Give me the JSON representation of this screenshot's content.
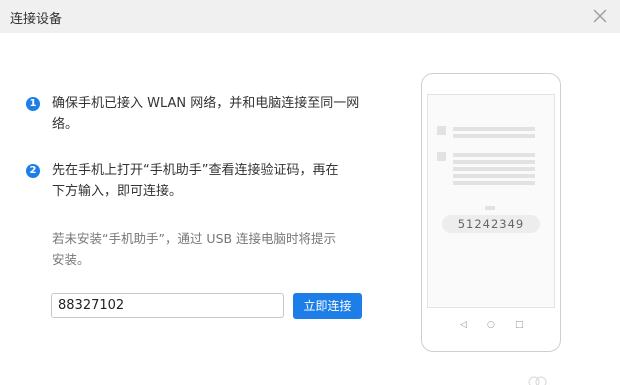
{
  "window": {
    "title": "连接设备",
    "close_icon": "close-icon"
  },
  "steps": [
    {
      "number": "1",
      "line1": "确保手机已接入 WLAN 网络，并和电脑连接至同一网",
      "line2": "络。"
    },
    {
      "number": "2",
      "line1": "先在手机上打开“手机助手”查看连接验证码，再在",
      "line2": "下方输入，即可连接。"
    }
  ],
  "note": {
    "line1": "若未安装“手机助手”，通过 USB 连接电脑时将提示",
    "line2": "安装。"
  },
  "form": {
    "code_value": "88327102",
    "connect_label": "立即连接"
  },
  "phone": {
    "verification_code": "51242349",
    "nav_back": "◁",
    "nav_home": "○",
    "nav_recent": "□"
  },
  "colors": {
    "accent": "#1e7ee8",
    "titlebar": "#f0f0f0"
  }
}
